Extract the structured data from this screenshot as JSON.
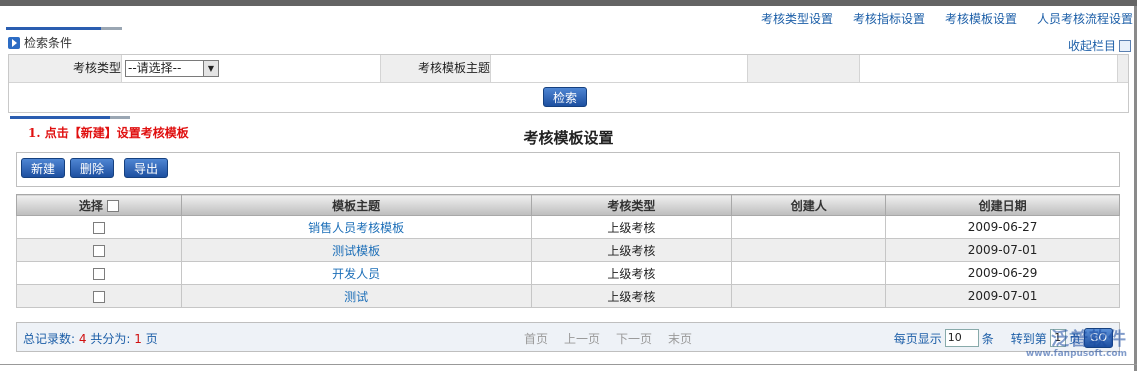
{
  "top_links": [
    "考核类型设置",
    "考核指标设置",
    "考核模板设置",
    "人员考核流程设置"
  ],
  "search_section": {
    "title": "检索条件",
    "collapse_label": "收起栏目",
    "type_label": "考核类型",
    "type_select_value": "--请选择--",
    "template_label": "考核模板主题",
    "template_value": "",
    "search_button": "检索"
  },
  "annotation": "1. 点击【新建】设置考核模板",
  "page_title": "考核模板设置",
  "toolbar": {
    "new": "新建",
    "delete": "删除",
    "export": "导出"
  },
  "table": {
    "headers": [
      "选择",
      "模板主题",
      "考核类型",
      "创建人",
      "创建日期"
    ],
    "rows": [
      {
        "subject": "销售人员考核模板",
        "type": "上级考核",
        "creator": "",
        "date": "2009-06-27"
      },
      {
        "subject": "测试模板",
        "type": "上级考核",
        "creator": "",
        "date": "2009-07-01"
      },
      {
        "subject": "开发人员",
        "type": "上级考核",
        "creator": "",
        "date": "2009-06-29"
      },
      {
        "subject": "测试",
        "type": "上级考核",
        "creator": "",
        "date": "2009-07-01"
      }
    ]
  },
  "pager": {
    "total_label": "总记录数:",
    "total": "4",
    "pages_label": "共分为:",
    "pages": "1",
    "page_unit": "页",
    "first": "首页",
    "prev": "上一页",
    "next": "下一页",
    "last": "末页",
    "per_page_label": "每页显示",
    "per_page": "10",
    "per_page_unit": "条",
    "goto_label": "转到第",
    "goto_page": "1",
    "goto_unit": "页",
    "go_button": "GO"
  },
  "watermark": {
    "brand": "泛普软件",
    "url": "www.fanpusoft.com"
  }
}
